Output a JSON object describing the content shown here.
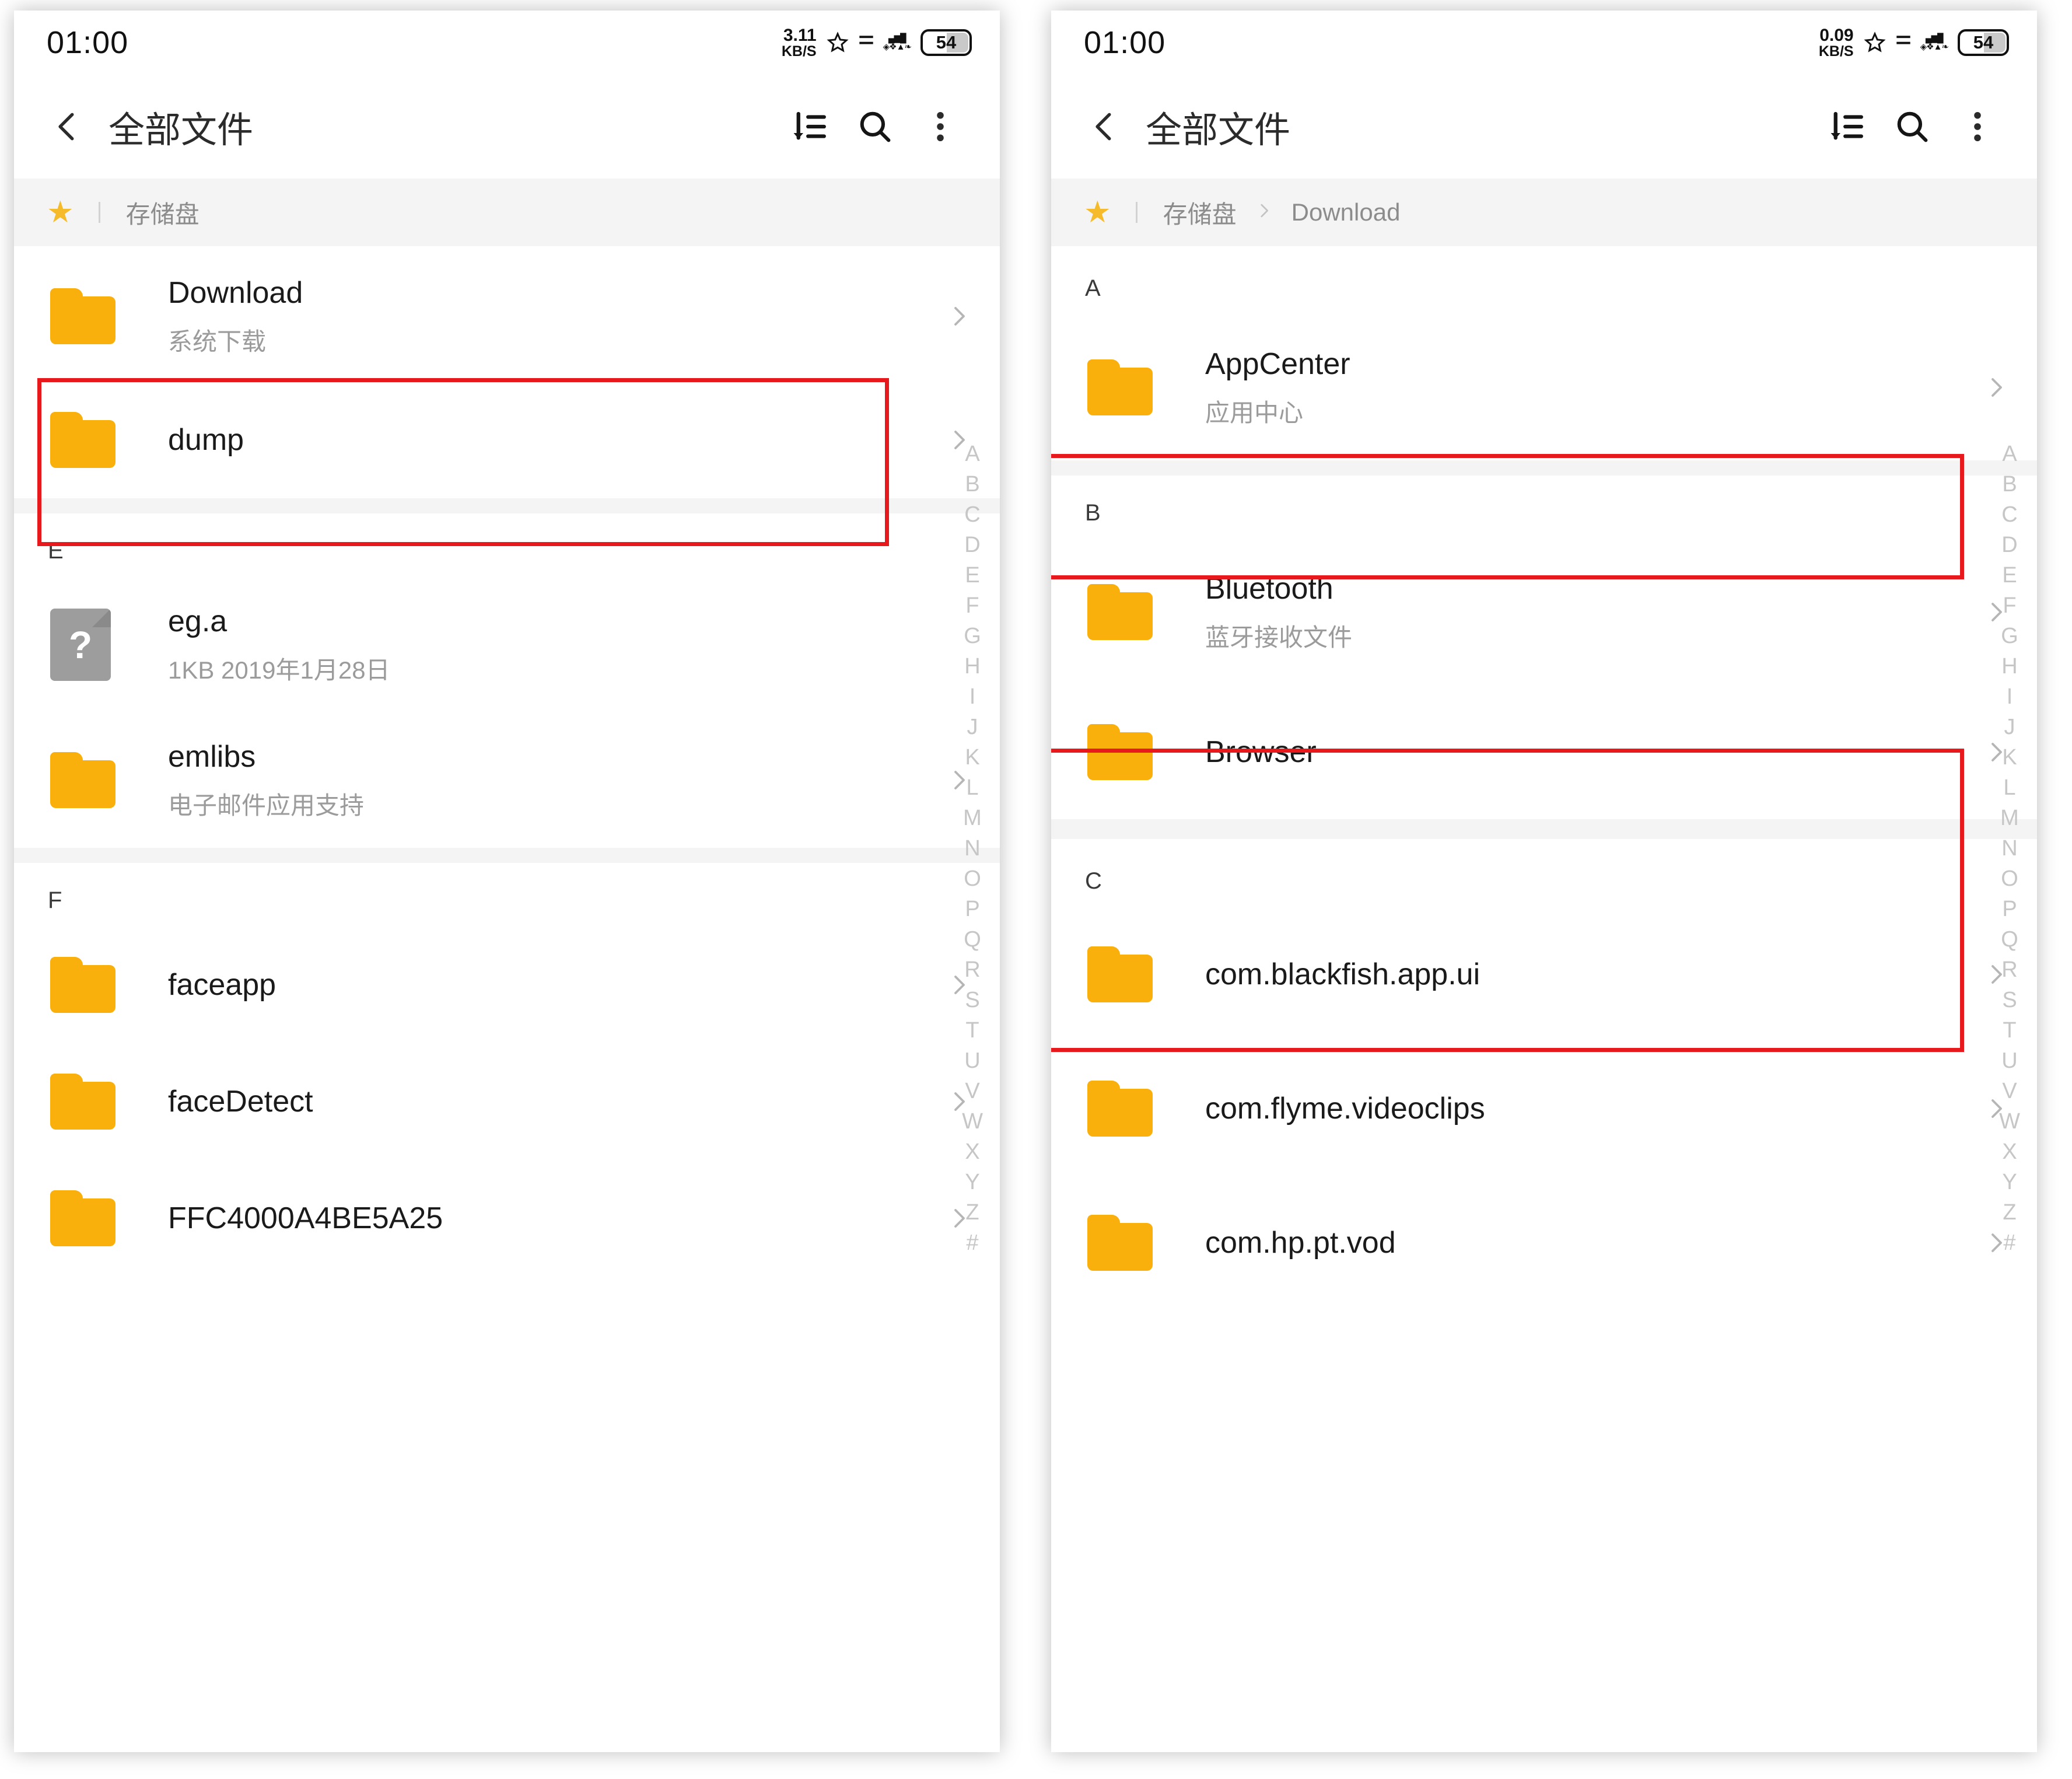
{
  "status_bar": {
    "time": "01:00",
    "left_speed": "3.11",
    "left_speed_unit": "KB/S",
    "right_speed": "0.09",
    "right_speed_unit": "KB/S",
    "battery": "54",
    "icons": [
      "star-outline-icon",
      "signal-bars-icon",
      "wifi-icon",
      "mobile-data-icon",
      "battery-icon"
    ]
  },
  "app_bar": {
    "title": "全部文件",
    "back_icon": "chevron-left-icon",
    "sort_icon": "sort-descending-icon",
    "search_icon": "search-icon",
    "more_icon": "more-vertical-icon"
  },
  "colors": {
    "folder": "#f9b00d",
    "star": "#f5bb2b",
    "highlight": "#e8191d",
    "subtitle": "#9b9b9b",
    "crumb": "#8c8c8c"
  },
  "alphabet_index": [
    "A",
    "B",
    "C",
    "D",
    "E",
    "F",
    "G",
    "H",
    "I",
    "J",
    "K",
    "L",
    "M",
    "N",
    "O",
    "P",
    "Q",
    "R",
    "S",
    "T",
    "U",
    "V",
    "W",
    "X",
    "Y",
    "Z",
    "#"
  ],
  "left_panel": {
    "breadcrumb": {
      "star_icon": "star-filled-icon",
      "items": [
        "存储盘"
      ]
    },
    "sections": [
      {
        "header": "",
        "rows": [
          {
            "icon": "folder-icon",
            "title": "Download",
            "subtitle": "系统下载",
            "highlighted": true
          },
          {
            "icon": "folder-icon",
            "title": "dump",
            "subtitle": "",
            "highlighted": false
          }
        ]
      },
      {
        "header": "E",
        "rows": [
          {
            "icon": "file-unknown-icon",
            "title": "eg.a",
            "subtitle": "1KB  2019年1月28日",
            "highlighted": false,
            "no_chevron": true
          },
          {
            "icon": "folder-icon",
            "title": "emlibs",
            "subtitle": "电子邮件应用支持",
            "highlighted": false
          }
        ]
      },
      {
        "header": "F",
        "rows": [
          {
            "icon": "folder-icon",
            "title": "faceapp",
            "subtitle": "",
            "highlighted": false
          },
          {
            "icon": "folder-icon",
            "title": "faceDetect",
            "subtitle": "",
            "highlighted": false
          },
          {
            "icon": "folder-icon",
            "title": "FFC4000A4BE5A25",
            "subtitle": "",
            "highlighted": false,
            "clipped": true
          }
        ]
      }
    ]
  },
  "right_panel": {
    "breadcrumb": {
      "star_icon": "star-filled-icon",
      "items": [
        "存储盘",
        "Download"
      ],
      "separator_icon": "chevron-right-icon"
    },
    "sections": [
      {
        "header": "A",
        "rows": [
          {
            "icon": "folder-icon",
            "title": "AppCenter",
            "subtitle": "应用中心",
            "highlighted": true
          }
        ]
      },
      {
        "header": "B",
        "rows": [
          {
            "icon": "folder-icon",
            "title": "Bluetooth",
            "subtitle": "蓝牙接收文件",
            "highlighted": true
          },
          {
            "icon": "folder-icon",
            "title": "Browser",
            "subtitle": "",
            "highlighted": true
          }
        ]
      },
      {
        "header": "C",
        "rows": [
          {
            "icon": "folder-icon",
            "title": "com.blackfish.app.ui",
            "subtitle": "",
            "highlighted": false
          },
          {
            "icon": "folder-icon",
            "title": "com.flyme.videoclips",
            "subtitle": "",
            "highlighted": false
          },
          {
            "icon": "folder-icon",
            "title": "com.hp.pt.vod",
            "subtitle": "",
            "highlighted": false
          }
        ]
      }
    ]
  }
}
